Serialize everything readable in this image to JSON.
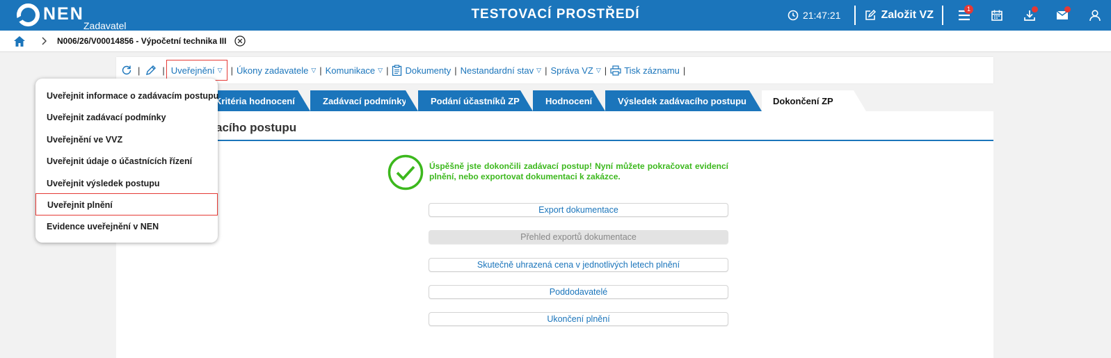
{
  "app": {
    "logo_text": "NEN",
    "logo_sub": "Zadavatel",
    "environment_title": "TESTOVACÍ PROSTŘEDÍ",
    "clock": "21:47:21",
    "create_label": "Založit VZ",
    "menu_badge": "1",
    "accent_color": "#1b75bb"
  },
  "breadcrumb": {
    "text": "N006/26/V00014856 - Výpočetní technika III"
  },
  "toolbar": {
    "items": [
      {
        "label": "Uveřejnění",
        "active": true
      },
      {
        "label": "Úkony zadavatele"
      },
      {
        "label": "Komunikace"
      },
      {
        "label": "Dokumenty"
      },
      {
        "label": "Nestandardní stav"
      },
      {
        "label": "Správa VZ"
      },
      {
        "label": "Tisk záznamu"
      }
    ]
  },
  "tabs": [
    {
      "label": "Kritéria hodnocení"
    },
    {
      "label": "Zadávací podmínky"
    },
    {
      "label": "Podání účastníků ZP"
    },
    {
      "label": "Hodnocení"
    },
    {
      "label": "Výsledek zadávacího postupu"
    },
    {
      "label": "Dokončení ZP",
      "active": true
    }
  ],
  "main": {
    "section_title": "acího postupu",
    "success_message": "Úspěšně jste dokončili zadávací postup! Nyní můžete pokračovat evidencí plnění, nebo exportovat dokumentaci k zakázce.",
    "actions": [
      {
        "label": "Export dokumentace",
        "enabled": true
      },
      {
        "label": "Přehled exportů dokumentace",
        "enabled": false
      },
      {
        "label": "Skutečně uhrazená cena v jednotlivých letech plnění",
        "enabled": true
      },
      {
        "label": "Poddodavatelé",
        "enabled": true
      },
      {
        "label": "Ukončení plnění",
        "enabled": true
      }
    ]
  },
  "dropdown": {
    "items": [
      {
        "label": "Uveřejnit informace o zadávacím postupu"
      },
      {
        "label": "Uveřejnit zadávací podmínky"
      },
      {
        "label": "Uveřejnění ve VVZ"
      },
      {
        "label": "Uveřejnit údaje o účastnících řízení"
      },
      {
        "label": "Uveřejnit výsledek postupu"
      },
      {
        "label": "Uveřejnit plnění",
        "highlighted": true
      },
      {
        "label": "Evidence uveřejnění v NEN"
      }
    ]
  }
}
